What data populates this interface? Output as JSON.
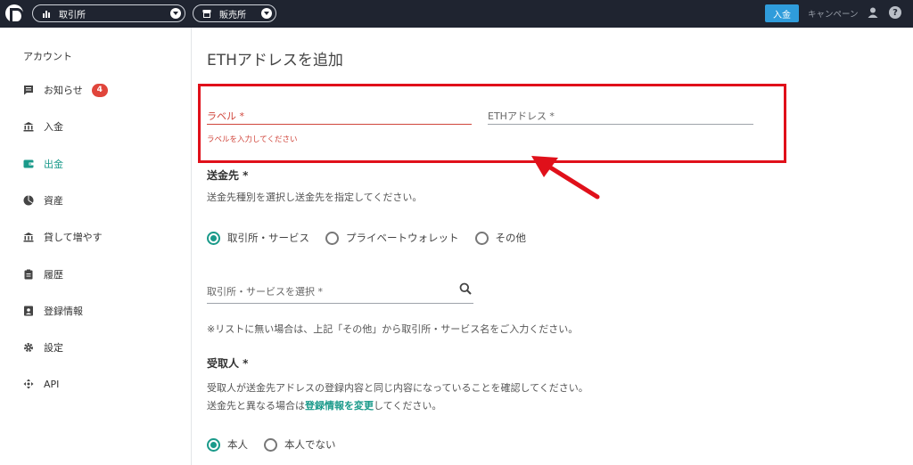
{
  "topbar": {
    "selector1": {
      "label": "取引所",
      "icon": "bar-chart-icon"
    },
    "selector2": {
      "label": "販売所",
      "icon": "store-icon"
    },
    "deposit_button": "入金",
    "campaign_link": "キャンペーン",
    "help_glyph": "?"
  },
  "sidebar": {
    "title": "アカウント",
    "items": [
      {
        "label": "お知らせ",
        "icon": "message-icon",
        "badge": "4"
      },
      {
        "label": "入金",
        "icon": "bank-icon"
      },
      {
        "label": "出金",
        "icon": "wallet-icon",
        "active": true
      },
      {
        "label": "資産",
        "icon": "pie-chart-icon"
      },
      {
        "label": "貸して増やす",
        "icon": "bank-icon"
      },
      {
        "label": "履歴",
        "icon": "clipboard-icon"
      },
      {
        "label": "登録情報",
        "icon": "id-card-icon"
      },
      {
        "label": "設定",
        "icon": "gear-icon"
      },
      {
        "label": "API",
        "icon": "api-icon"
      }
    ],
    "active_color": "#1a9a8a",
    "badge_color": "#e0453b"
  },
  "main": {
    "title": "ETHアドレスを追加",
    "label_field": {
      "label": "ラベル *",
      "error": "ラベルを入力してください"
    },
    "eth_field": {
      "label": "ETHアドレス *"
    },
    "destination": {
      "heading": "送金先 *",
      "description": "送金先種別を選択し送金先を指定してください。",
      "options": [
        {
          "label": "取引所・サービス",
          "selected": true
        },
        {
          "label": "プライベートウォレット",
          "selected": false
        },
        {
          "label": "その他",
          "selected": false
        }
      ],
      "search_placeholder": "取引所・サービスを選択 *",
      "note": "※リストに無い場合は、上記「その他」から取引所・サービス名をご入力ください。"
    },
    "recipient": {
      "heading": "受取人 *",
      "line1": "受取人が送金先アドレスの登録内容と同じ内容になっていることを確認してください。",
      "line2_prefix": "送金先と異なる場合は",
      "line2_link": "登録情報を変更",
      "line2_suffix": "してください。",
      "options": [
        {
          "label": "本人",
          "selected": true
        },
        {
          "label": "本人でない",
          "selected": false
        }
      ]
    },
    "highlight_color": "#e0101a",
    "error_color": "#d0453b"
  }
}
